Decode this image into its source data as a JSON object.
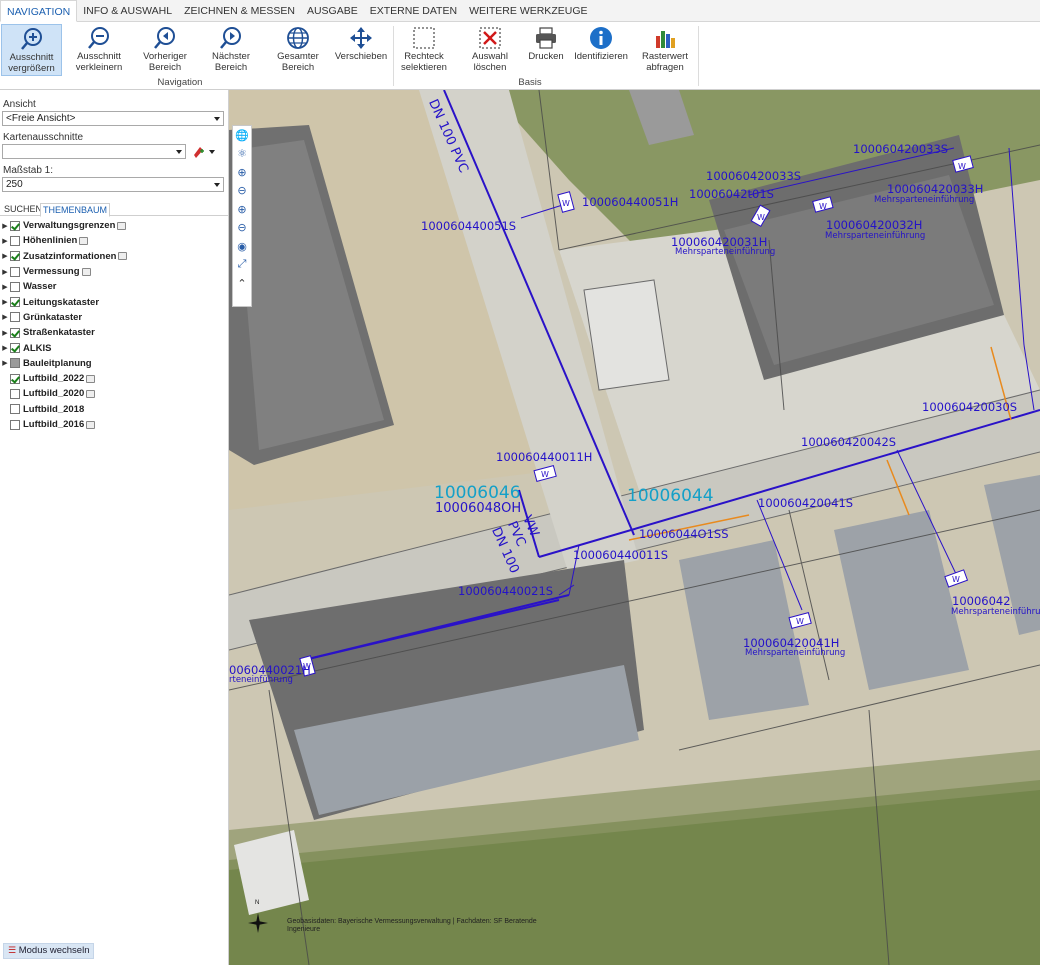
{
  "ribbon": {
    "tabs": [
      {
        "label": "NAVIGATION",
        "active": true
      },
      {
        "label": "INFO & AUSWAHL"
      },
      {
        "label": "ZEICHNEN & MESSEN"
      },
      {
        "label": "AUSGABE"
      },
      {
        "label": "EXTERNE DATEN"
      },
      {
        "label": "WEITERE WERKZEUGE"
      }
    ],
    "buttons": [
      {
        "label": "Ausschnitt vergrößern",
        "icon": "zoom-in-icon",
        "active": true
      },
      {
        "label": "Ausschnitt verkleinern",
        "icon": "zoom-out-icon"
      },
      {
        "label": "Vorheriger Bereich",
        "icon": "previous-extent-icon"
      },
      {
        "label": "Nächster Bereich",
        "icon": "next-extent-icon"
      },
      {
        "label": "Gesamter Bereich",
        "icon": "globe-icon"
      },
      {
        "label": "Verschieben",
        "icon": "pan-icon"
      },
      {
        "label": "Rechteck selektieren",
        "icon": "rectangle-select-icon"
      },
      {
        "label": "Auswahl löschen",
        "icon": "clear-selection-icon"
      },
      {
        "label": "Drucken",
        "icon": "printer-icon"
      },
      {
        "label": "Identifizieren",
        "icon": "info-icon"
      },
      {
        "label": "Rasterwert abfragen",
        "icon": "bar-chart-icon"
      }
    ],
    "groups": {
      "navigation": "Navigation",
      "basis": "Basis"
    }
  },
  "panel": {
    "ansicht_label": "Ansicht",
    "ansicht_value": "<Freie Ansicht>",
    "kartenausschnitte_label": "Kartenausschnitte",
    "kartenausschnitte_value": "",
    "massstab_label": "Maßstab 1:",
    "massstab_value": "250",
    "tabs": [
      {
        "label": "SUCHEN"
      },
      {
        "label": "THEMENBAUM",
        "active": true
      }
    ],
    "layers": [
      {
        "label": "Verwaltungsgrenzen",
        "state": "on",
        "expandable": true,
        "info": true
      },
      {
        "label": "Höhenlinien",
        "state": "off",
        "expandable": true,
        "info": true
      },
      {
        "label": "Zusatzinformationen",
        "state": "on",
        "expandable": true,
        "info": true
      },
      {
        "label": "Vermessung",
        "state": "off",
        "expandable": true,
        "info": true
      },
      {
        "label": "Wasser",
        "state": "off",
        "expandable": true,
        "info": false
      },
      {
        "label": "Leitungskataster",
        "state": "on",
        "expandable": true,
        "info": false
      },
      {
        "label": "Grünkataster",
        "state": "off",
        "expandable": true,
        "info": false
      },
      {
        "label": "Straßenkataster",
        "state": "on",
        "expandable": true,
        "info": false
      },
      {
        "label": "ALKIS",
        "state": "on",
        "expandable": true,
        "info": false
      },
      {
        "label": "Bauleitplanung",
        "state": "partial",
        "expandable": true,
        "info": false
      },
      {
        "label": "Luftbild_2022",
        "state": "on",
        "expandable": false,
        "info": true
      },
      {
        "label": "Luftbild_2020",
        "state": "off",
        "expandable": false,
        "info": true
      },
      {
        "label": "Luftbild_2018",
        "state": "off",
        "expandable": false,
        "info": false
      },
      {
        "label": "Luftbild_2016",
        "state": "off",
        "expandable": false,
        "info": true
      }
    ],
    "mode_switch": "Modus wechseln"
  },
  "map": {
    "labels": {
      "dn100pvc_top": "DN 100 PVC",
      "l_051h": "100060440051H",
      "l_051s": "100060440051S",
      "l_033s_top": "100060420033S",
      "l_033s_mid": "100060420033S",
      "l_01s": "10006042t01S",
      "l_033h": "100060420033H",
      "l_033h_sub": "Mehrsparteneinführung",
      "l_032h": "100060420032H",
      "l_032h_sub": "Mehrsparteneinführung",
      "l_031h": "100060420031H",
      "l_031h_sub": "Mehrsparteneinführung",
      "l_030s": "100060420030S",
      "l_042s": "100060420042S",
      "l_011h": "100060440011H",
      "l_big1": "10006046",
      "l_048": "10006048OH",
      "l_big2": "10006044",
      "l_041s": "100060420041S",
      "l_401ss": "10006044O1SS",
      "l_011s": "100060440011S",
      "l_vw": "VW",
      "l_pvc": "PVC",
      "l_dn100": "DN 100",
      "l_021s": "100060440021S",
      "l_042_right": "10006042",
      "l_mehr_right": "Mehrsparteneinführung",
      "l_041h": "100060420041H",
      "l_041h_sub": "Mehrsparteneinführung",
      "l_021h": "0060440021H",
      "l_021h_sub": "rteneinführung"
    },
    "tools": [
      "globe-icon",
      "globe-nav-icon",
      "zoom-in-icon",
      "zoom-out-icon",
      "zoom-in-small-icon",
      "zoom-out-small-icon",
      "locate-icon",
      "full-extent-icon",
      "collapse-up-icon"
    ],
    "copyright": "Geobasisdaten: Bayerische Vermessungsverwaltung | Fachdaten: SF Beratende Ingenieure",
    "north": "N",
    "colors": {
      "pipe": "#2a12c8",
      "orange_pipe": "#e88a1e",
      "label": "#2412c8",
      "big_label": "#14a0c8"
    }
  }
}
